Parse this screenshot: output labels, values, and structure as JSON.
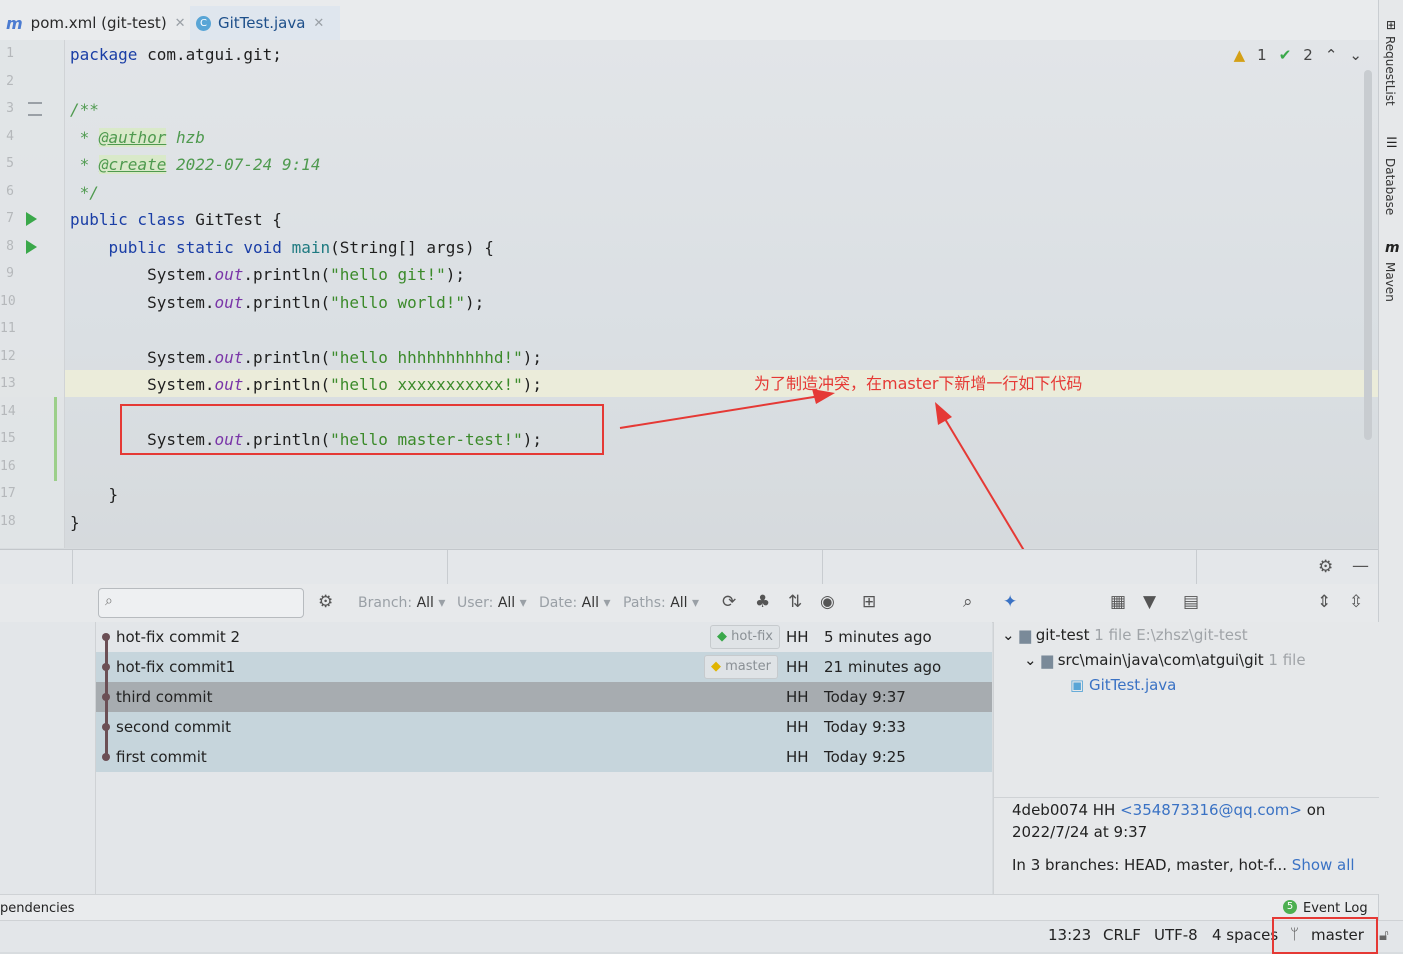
{
  "tabs": [
    {
      "icon": "m",
      "label": "pom.xml (git-test)"
    },
    {
      "icon": "C",
      "label": "GitTest.java"
    }
  ],
  "inspections": {
    "warnings": "1",
    "ok": "2"
  },
  "line_numbers": [
    "1",
    "2",
    "3",
    "4",
    "5",
    "6",
    "7",
    "8",
    "9",
    "10",
    "11",
    "12",
    "13",
    "14",
    "15",
    "16",
    "17",
    "18"
  ],
  "code": {
    "pkg_kw": "package",
    "pkg_name": " com.atgui.git;",
    "doc_open": "/**",
    "author_tag": "@author",
    "author_val": " hzb",
    "create_tag": "@create",
    "create_val": " 2022-07-24 9:14",
    "doc_close": " */",
    "class_decl_kw": "public class",
    "class_decl_rest": " GitTest {",
    "main_kw": "public static void",
    "main_name": "main",
    "main_rest": "(String[] args) {",
    "sys": "System.",
    "out": "out",
    "println": ".println(",
    "str1": "\"hello git!\"",
    "str2": "\"hello world!\"",
    "str3": "\"hello hhhhhhhhhhd!\"",
    "str4": "\"hello xxxxxxxxxxx!\"",
    "str5": "\"hello master-test!\"",
    "close_call": ");",
    "brace_close": "}"
  },
  "right_strip": {
    "request": "RequestList",
    "database": "Database",
    "maven": "Maven"
  },
  "annotation": "为了制造冲突，在master下新增一行如下代码",
  "log_toolbar": {
    "branch_label": "Branch:",
    "branch_val": "All",
    "user_label": "User:",
    "user_val": "All",
    "date_label": "Date:",
    "date_val": "All",
    "paths_label": "Paths:",
    "paths_val": "All"
  },
  "commits": [
    {
      "message": "hot-fix commit 2",
      "label": "hot-fix",
      "author": "HH",
      "date": "5 minutes ago"
    },
    {
      "message": "hot-fix commit1",
      "label": "master",
      "author": "HH",
      "date": "21 minutes ago"
    },
    {
      "message": "third commit",
      "label": "",
      "author": "HH",
      "date": "Today 9:37"
    },
    {
      "message": "second commit",
      "label": "",
      "author": "HH",
      "date": "Today 9:33"
    },
    {
      "message": "first commit",
      "label": "",
      "author": "HH",
      "date": "Today 9:25"
    }
  ],
  "details": {
    "root": "git-test",
    "root_meta": "1 file  E:\\zhsz\\git-test",
    "dir": "src\\main\\java\\com\\atgui\\git",
    "dir_meta": "1 file",
    "file": "GitTest.java",
    "hash_author": "4deb0074 HH ",
    "email": "<354873316@qq.com>",
    "on": " on",
    "date": "2022/7/24 at 9:37",
    "branches": "In 3 branches: HEAD, master, hot-f... ",
    "show_all": "Show all"
  },
  "toolstrip": {
    "left": "pendencies",
    "event_count": "5",
    "event_log": "Event Log"
  },
  "status": {
    "position": "13:23",
    "line_sep": "CRLF",
    "encoding": "UTF-8",
    "indent": "4 spaces",
    "branch": "master"
  },
  "colors": {
    "accent": "#4a86c8",
    "annotation": "#e53935",
    "selected_row": "#9ea4a8",
    "row_blue": "#c3d3da"
  }
}
